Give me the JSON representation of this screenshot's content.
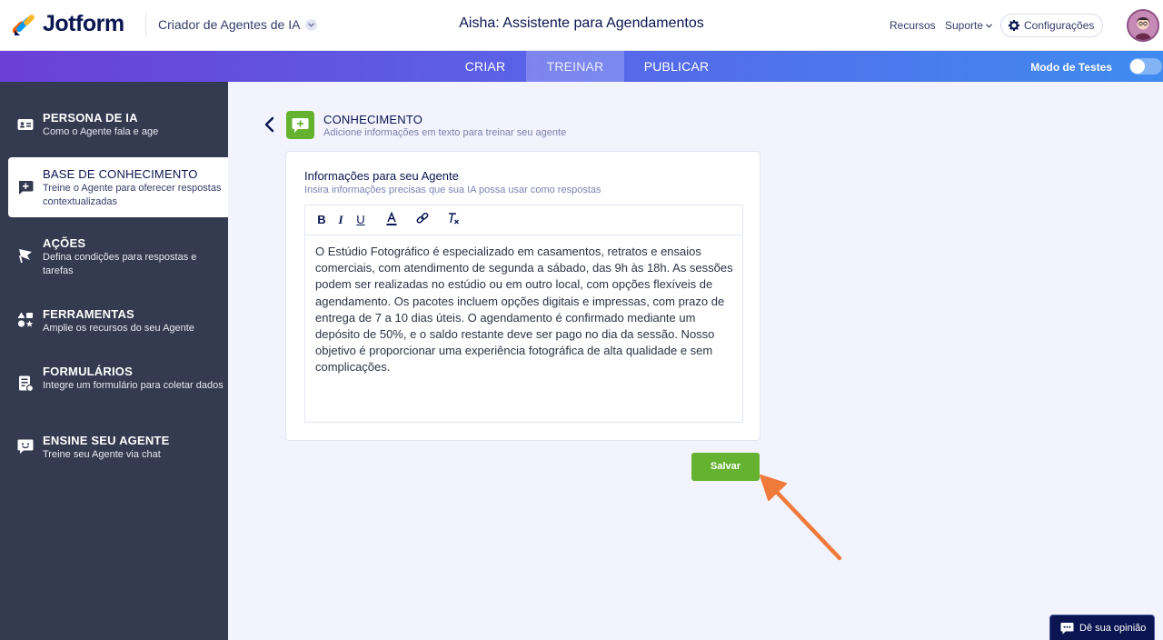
{
  "header": {
    "brand": "Jotform",
    "builder_label": "Criador de Agentes de IA",
    "agent_title": "Aisha: Assistente para Agendamentos",
    "resources": "Recursos",
    "support": "Suporte",
    "settings": "Configurações"
  },
  "tabs": [
    {
      "label": "CRIAR",
      "active": false
    },
    {
      "label": "TREINAR",
      "active": true
    },
    {
      "label": "PUBLICAR",
      "active": false
    }
  ],
  "test_mode": {
    "label": "Modo de Testes",
    "enabled": false
  },
  "sidebar": {
    "items": [
      {
        "title": "PERSONA DE IA",
        "desc": "Como o Agente fala e age",
        "icon": "id-card-icon"
      },
      {
        "title": "BASE DE CONHECIMENTO",
        "desc": "Treine o Agente para oferecer respostas contextualizadas",
        "icon": "chat-plus-icon",
        "active": true
      },
      {
        "title": "AÇÕES",
        "desc": "Defina condições para respostas e tarefas",
        "icon": "flag-icon"
      },
      {
        "title": "FERRAMENTAS",
        "desc": "Amplie os recursos do seu Agente",
        "icon": "shapes-icon"
      },
      {
        "title": "FORMULÁRIOS",
        "desc": "Integre um formulário para coletar dados",
        "icon": "form-icon"
      },
      {
        "title": "ENSINE SEU AGENTE",
        "desc": "Treine seu Agente via chat",
        "icon": "chat-smile-icon"
      }
    ]
  },
  "knowledge": {
    "title": "CONHECIMENTO",
    "subtitle": "Adicione informações em texto para treinar seu agente"
  },
  "card": {
    "title": "Informações para seu Agente",
    "subtitle": "Insira informações precisas que sua IA possa usar como respostas",
    "toolbar": [
      "bold",
      "italic",
      "underline",
      "text-color",
      "link",
      "clear-format"
    ],
    "content": "O Estúdio Fotográfico é especializado em casamentos, retratos e ensaios comerciais, com atendimento de segunda a sábado, das 9h às 18h. As sessões podem ser realizadas no estúdio ou em outro local, com opções flexíveis de agendamento. Os pacotes incluem opções digitais e impressas, com prazo de entrega de 7 a 10 dias úteis. O agendamento é confirmado mediante um depósito de 50%, e o saldo restante deve ser pago no dia da sessão. Nosso objetivo é proporcionar uma experiência fotográfica de alta qualidade e sem complicações."
  },
  "save_label": "Salvar",
  "feedback_label": "Dê sua opinião",
  "colors": {
    "accent_green": "#64b22f",
    "sidebar_bg": "#343a4f",
    "navy": "#0a1551",
    "annotation_arrow": "#f07a3a"
  }
}
